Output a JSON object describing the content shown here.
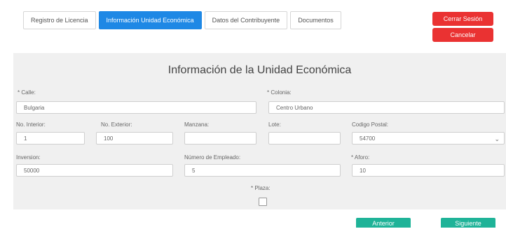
{
  "tabs": [
    {
      "label": "Registro de Licencia"
    },
    {
      "label": "Información Unidad Económica"
    },
    {
      "label": "Datos del Contribuyente"
    },
    {
      "label": "Documentos"
    }
  ],
  "active_tab_index": 1,
  "header_buttons": {
    "logout_label": "Cerrar Sesión",
    "cancel_label": "Cancelar"
  },
  "form": {
    "title": "Información de la Unidad Económica",
    "fields": {
      "calle": {
        "label": "* Calle:",
        "value": "Bulgaria"
      },
      "colonia": {
        "label": "* Colonia:",
        "value": "Centro Urbano"
      },
      "no_interior": {
        "label": "No. Interior:",
        "value": "1"
      },
      "no_exterior": {
        "label": "No. Exterior:",
        "value": "100"
      },
      "manzana": {
        "label": "Manzana:",
        "value": ""
      },
      "lote": {
        "label": "Lote:",
        "value": ""
      },
      "codigo_postal": {
        "label": "Codigo Postal:",
        "value": "54700"
      },
      "inversion": {
        "label": "Inversion:",
        "value": "50000"
      },
      "numero_empleado": {
        "label": "Número de Empleado:",
        "value": "5"
      },
      "aforo": {
        "label": "* Aforo:",
        "value": "10"
      },
      "plaza": {
        "label": "* Plaza:",
        "checked": false
      }
    }
  },
  "nav_buttons": {
    "prev_label": "Anterior",
    "next_label": "Siguiente"
  },
  "colors": {
    "active_tab": "#1e88e5",
    "danger": "#ea3232",
    "success": "#1fb398",
    "panel_bg": "#f0f0f0"
  }
}
